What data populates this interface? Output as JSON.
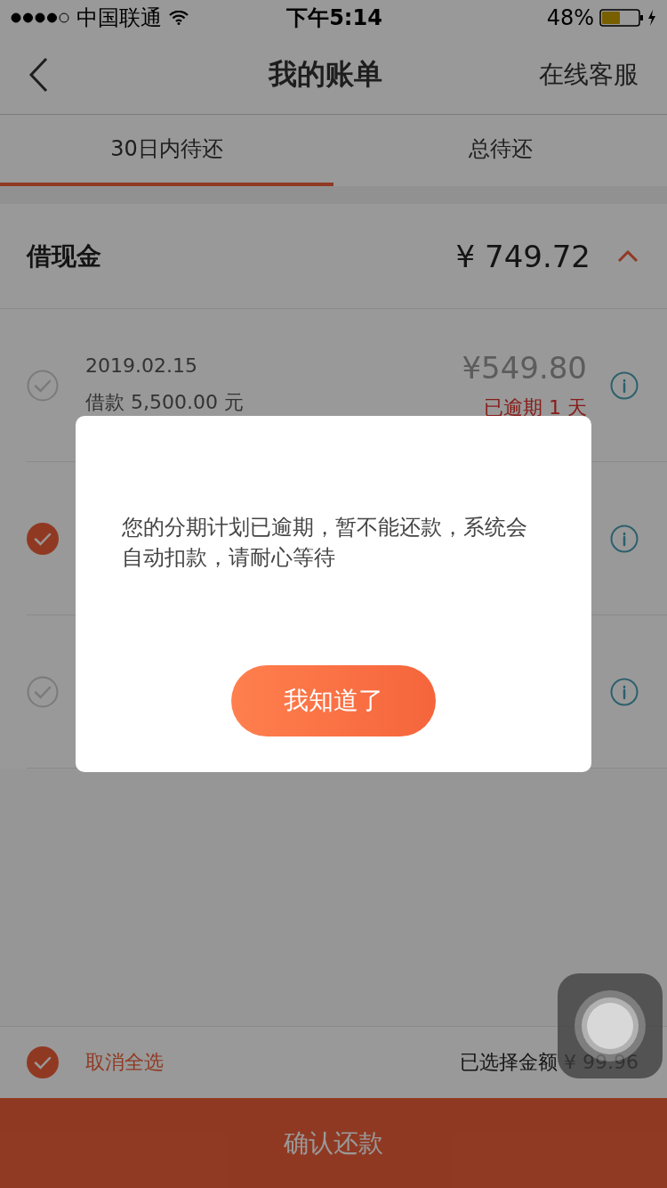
{
  "status_bar": {
    "carrier": "中国联通",
    "time": "下午5:14",
    "battery": "48%"
  },
  "nav": {
    "title": "我的账单",
    "action": "在线客服"
  },
  "tabs": [
    {
      "label": "30日内待还",
      "selected": true
    },
    {
      "label": "总待还",
      "selected": false
    }
  ],
  "section": {
    "title": "借现金",
    "total": "¥ 749.72",
    "expanded": true
  },
  "bills": [
    {
      "checked": false,
      "date": "2019.02.15",
      "loan": "借款 5,500.00 元",
      "amount": "¥549.80",
      "status": "已逾期 1 天"
    },
    {
      "checked": true
    },
    {
      "checked": false
    }
  ],
  "footer": {
    "select_all_checked": true,
    "select_all": "取消全选",
    "selected_amount": "已选择金额 ¥ 99.96",
    "confirm": "确认还款"
  },
  "dialog": {
    "message": "您的分期计划已逾期，暂不能还款，系统会自动扣款，请耐心等待",
    "button": "我知道了"
  }
}
